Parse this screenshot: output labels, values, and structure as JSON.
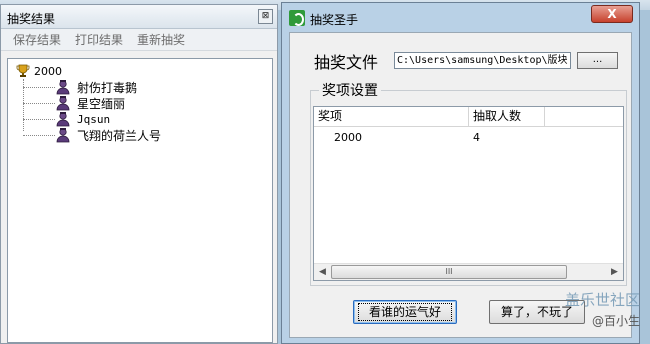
{
  "results_window": {
    "title": "抽奖结果",
    "close_glyph": "⊠",
    "menu": [
      "保存结果",
      "打印结果",
      "重新抽奖"
    ],
    "tree": {
      "root_label": "2000",
      "root_icon": "trophy-icon",
      "children": [
        {
          "label": "射伤打毒鹅",
          "icon": "person-icon"
        },
        {
          "label": "星空缅丽",
          "icon": "person-icon"
        },
        {
          "label": "Jqsun",
          "icon": "person-icon"
        },
        {
          "label": "飞翔的荷兰人号",
          "icon": "person-icon"
        }
      ]
    }
  },
  "main_window": {
    "title": "抽奖圣手",
    "close_label": "X",
    "file_label": "抽奖文件",
    "file_path": "C:\\Users\\samsung\\Desktop\\版块",
    "browse_label": "...",
    "group_title": "奖项设置",
    "table": {
      "columns": [
        "奖项",
        "抽取人数"
      ],
      "rows": [
        {
          "prize": "2000",
          "count": "4"
        }
      ]
    },
    "scroll_thumb_glyph": "III",
    "buttons": {
      "lucky": "看谁的运气好",
      "quit": "算了，不玩了"
    }
  },
  "watermark": {
    "line1": "盖乐世社区",
    "line2": "@百小生"
  },
  "colors": {
    "desktop_bg": "#a9c4d9",
    "close_red": "#c7412d",
    "app_icon_green": "#2f9a3a"
  }
}
